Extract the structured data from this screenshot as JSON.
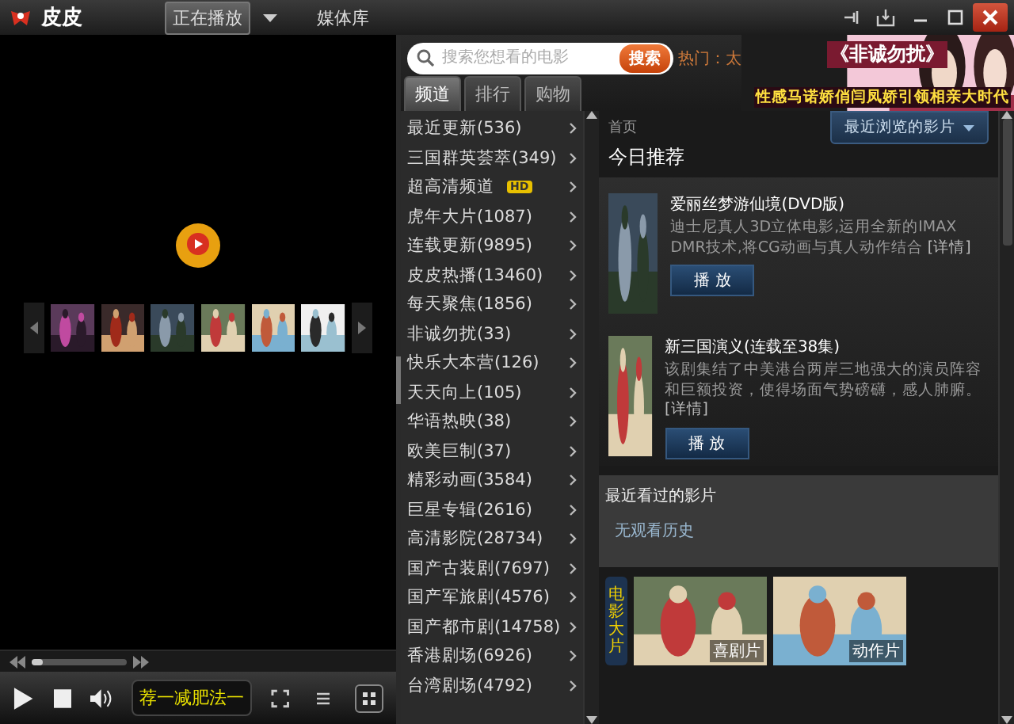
{
  "app": {
    "title": "皮皮"
  },
  "nav": [
    {
      "label": "正在播放",
      "selected": true,
      "kind": "dropdown"
    },
    {
      "label": "媒体库",
      "selected": false,
      "kind": "plain"
    }
  ],
  "search": {
    "placeholder": "搜索您想看的电影",
    "button": "搜索",
    "hot": "热门：太"
  },
  "banner": {
    "title": "《非诚勿扰》",
    "subtitle": "性感马诺娇俏闫凤娇引领相亲大时代"
  },
  "tabs": [
    {
      "label": "频道",
      "selected": true
    },
    {
      "label": "排行",
      "selected": false
    },
    {
      "label": "购物",
      "selected": false
    }
  ],
  "categories": [
    {
      "label": "最近更新(536)"
    },
    {
      "label": "三国群英荟萃(349)"
    },
    {
      "label": "超高清频道",
      "badge": "HD"
    },
    {
      "label": "虎年大片(1087)"
    },
    {
      "label": "连载更新(9895)"
    },
    {
      "label": "皮皮热播(13460)"
    },
    {
      "label": "每天聚焦(1856)"
    },
    {
      "label": "非诚勿扰(33)"
    },
    {
      "label": "快乐大本营(126)"
    },
    {
      "label": "天天向上(105)"
    },
    {
      "label": "华语热映(38)"
    },
    {
      "label": "欧美巨制(37)"
    },
    {
      "label": "精彩动画(3584)"
    },
    {
      "label": "巨星专辑(2616)"
    },
    {
      "label": "高清影院(28734)"
    },
    {
      "label": "国产古装剧(7697)"
    },
    {
      "label": "国产军旅剧(4576)"
    },
    {
      "label": "国产都市剧(14758)"
    },
    {
      "label": "香港剧场(6926)"
    },
    {
      "label": "台湾剧场(4792)"
    }
  ],
  "content": {
    "breadcrumb": "首页",
    "heading": "今日推荐",
    "recent_dropdown": "最近浏览的影片",
    "recommendations": [
      {
        "title": "爱丽丝梦游仙境(DVD版)",
        "description": "迪士尼真人3D立体电影,运用全新的IMAX DMR技术,将CG动画与真人动作结合",
        "detail": "[详情]",
        "button": "播 放"
      },
      {
        "title": "新三国演义(连载至38集)",
        "description": "该剧集结了中美港台两岸三地强大的演员阵容和巨额投资，使得场面气势磅礴，感人肺腑。",
        "detail": "[详情]",
        "button": "播 放"
      }
    ],
    "history": {
      "title": "最近看过的影片",
      "empty": "无观看历史"
    },
    "strip": {
      "label": "电影大片",
      "items": [
        {
          "label": "喜剧片"
        },
        {
          "label": "动作片"
        }
      ]
    }
  },
  "player": {
    "seek": {
      "level": 0.12
    },
    "ticker": "荐一减肥法一",
    "views": [
      {
        "kind": "list",
        "selected": false
      },
      {
        "kind": "grid",
        "selected": true
      }
    ]
  }
}
